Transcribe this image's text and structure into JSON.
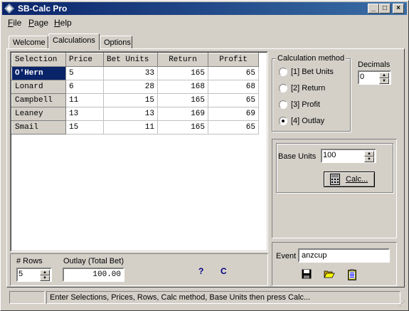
{
  "window": {
    "title": "SB-Calc  Pro"
  },
  "titlebar_buttons": {
    "minimize": "_",
    "maximize": "□",
    "close": "×"
  },
  "menu": [
    {
      "label": "File",
      "accel": "F",
      "rest": "ile"
    },
    {
      "label": "Page",
      "accel": "P",
      "rest": "age"
    },
    {
      "label": "Help",
      "accel": "H",
      "rest": "elp"
    }
  ],
  "tabs": [
    {
      "label": "Welcome",
      "active": false
    },
    {
      "label": "Calculations",
      "active": true
    },
    {
      "label": "Options",
      "active": false
    }
  ],
  "grid": {
    "columns": [
      "Selection",
      "Price",
      "Bet Units",
      "Return",
      "Profit"
    ],
    "rows": [
      {
        "selection": "O'Hern",
        "price": "5",
        "bet_units": "33",
        "return": "165",
        "profit": "65",
        "selected": true
      },
      {
        "selection": "Lonard",
        "price": "6",
        "bet_units": "28",
        "return": "168",
        "profit": "68"
      },
      {
        "selection": "Campbell",
        "price": "11",
        "bet_units": "15",
        "return": "165",
        "profit": "65"
      },
      {
        "selection": "Leaney",
        "price": "13",
        "bet_units": "13",
        "return": "169",
        "profit": "69"
      },
      {
        "selection": "Smail",
        "price": "15",
        "bet_units": "11",
        "return": "165",
        "profit": "65"
      }
    ]
  },
  "rows_control": {
    "label": "# Rows",
    "value": "5"
  },
  "outlay": {
    "label": "Outlay (Total Bet)",
    "value": "100.00"
  },
  "help_links": {
    "question": "?",
    "c": "C"
  },
  "calc_method": {
    "title": "Calculation method",
    "options": [
      {
        "label": "[1] Bet Units",
        "checked": false
      },
      {
        "label": "[2] Return",
        "checked": false
      },
      {
        "label": "[3] Profit",
        "checked": false
      },
      {
        "label": "[4] Outlay",
        "checked": true
      }
    ]
  },
  "decimals": {
    "label": "Decimals",
    "value": "0"
  },
  "base_units": {
    "label": "Base Units",
    "value": "100"
  },
  "calc_button": {
    "label": "Calc..."
  },
  "event": {
    "label": "Event",
    "value": "anzcup"
  },
  "icons": {
    "save": "floppy-disk-icon",
    "open": "folder-open-icon",
    "clipboard": "clipboard-icon"
  },
  "status": {
    "left": "",
    "message": "Enter Selections, Prices, Rows, Calc method, Base Units then press Calc..."
  }
}
